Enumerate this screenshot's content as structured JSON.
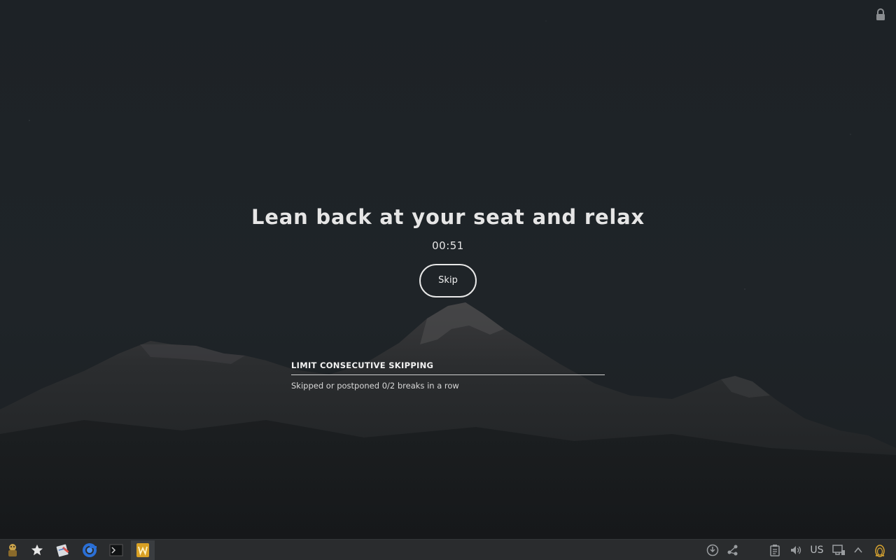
{
  "break_screen": {
    "title": "Lean back at your seat and relax",
    "countdown": "00:51",
    "skip_label": "Skip"
  },
  "limit_panel": {
    "heading": "LIMIT CONSECUTIVE SKIPPING",
    "status_text": "Skipped or postponed 0/2 breaks in a row"
  },
  "taskbar": {
    "launchers": [
      {
        "icon": "menu-mascot-icon"
      },
      {
        "icon": "favorites-star-icon"
      },
      {
        "icon": "text-editor-icon"
      },
      {
        "icon": "chromium-browser-icon"
      },
      {
        "icon": "terminal-icon"
      },
      {
        "icon": "office-writer-icon"
      }
    ],
    "tray": {
      "keyboard_layout": "US"
    }
  },
  "colors": {
    "background": "#1c2024",
    "text": "#e6e6e6",
    "taskbar": "#2a2c2e"
  }
}
